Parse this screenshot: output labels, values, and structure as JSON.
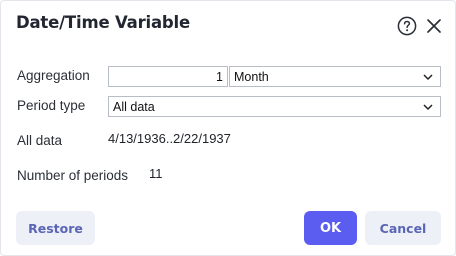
{
  "dialog": {
    "title": "Date/Time Variable",
    "help_icon": "question-circle-icon",
    "close_icon": "close-x-icon"
  },
  "aggregation": {
    "label": "Aggregation",
    "count_value": "1",
    "unit_selected": "Month"
  },
  "period_type": {
    "label": "Period type",
    "selected": "All data"
  },
  "all_data": {
    "label": "All data",
    "value": "4/13/1936..2/22/1937"
  },
  "number_of_periods": {
    "label": "Number of periods",
    "value": "11"
  },
  "buttons": {
    "restore": "Restore",
    "ok": "OK",
    "cancel": "Cancel"
  },
  "colors": {
    "primary": "#5b5df0",
    "secondary_bg": "#eef0f8",
    "secondary_text": "#5a65b6"
  }
}
